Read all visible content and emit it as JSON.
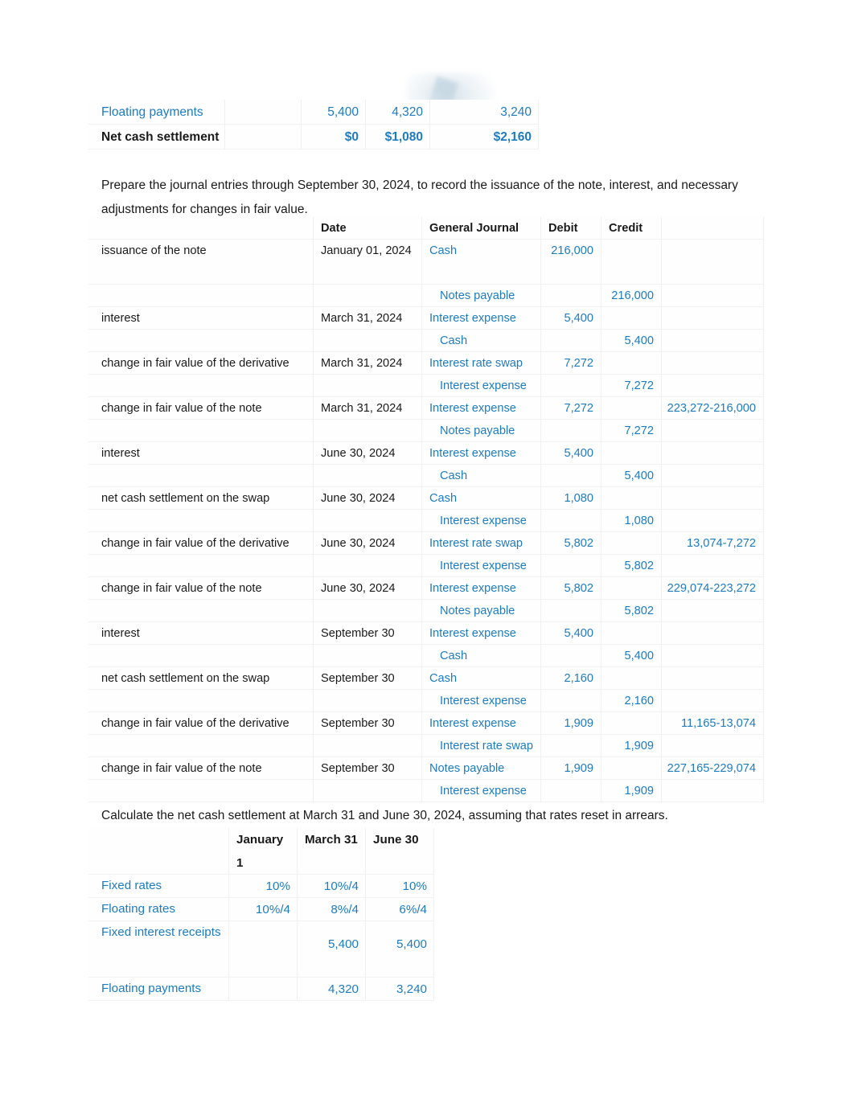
{
  "colors": {
    "accent_blue": "#1d7cc0",
    "text_black": "#1a1a1a",
    "cell_bg": "#fefefe"
  },
  "top_table": {
    "rows": [
      {
        "label": "Floating payments",
        "label_color": "blue",
        "bold": false,
        "c1": "5,400",
        "c2": "4,320",
        "c3": "3,240"
      },
      {
        "label": "Net cash settlement",
        "label_color": "black",
        "bold": true,
        "c1": "$0",
        "c2": "$1,080",
        "c3": "$2,160"
      }
    ]
  },
  "prompts": {
    "journal_entries": "Prepare the journal entries through September 30, 2024, to record the issuance of the note, interest, and necessary adjustments for changes in fair value.",
    "net_cash_settlement": "Calculate the net cash settlement at March 31 and June 30, 2024, assuming that rates reset in arrears."
  },
  "journal_table": {
    "headers": {
      "desc": "",
      "date": "Date",
      "account": "General Journal",
      "debit": "Debit",
      "credit": "Credit",
      "note": ""
    },
    "rows": [
      {
        "desc": "issuance of the note",
        "date": "January 01, 2024",
        "account": "Cash",
        "indent": false,
        "debit": "216,000",
        "credit": "",
        "note": ""
      },
      {
        "desc": "",
        "date": "",
        "account": "Notes payable",
        "indent": true,
        "debit": "",
        "credit": "216,000",
        "note": ""
      },
      {
        "desc": "interest",
        "date": "March 31, 2024",
        "account": "Interest expense",
        "indent": false,
        "debit": "5,400",
        "credit": "",
        "note": ""
      },
      {
        "desc": "",
        "date": "",
        "account": "Cash",
        "indent": true,
        "debit": "",
        "credit": "5,400",
        "note": ""
      },
      {
        "desc": "change in fair value of the derivative",
        "date": "March 31, 2024",
        "account": "Interest rate swap",
        "indent": false,
        "debit": "7,272",
        "credit": "",
        "note": ""
      },
      {
        "desc": "",
        "date": "",
        "account": "Interest expense",
        "indent": true,
        "debit": "",
        "credit": "7,272",
        "note": ""
      },
      {
        "desc": "change in fair value of the note",
        "date": "March 31, 2024",
        "account": "Interest expense",
        "indent": false,
        "debit": "7,272",
        "credit": "",
        "note": "223,272-216,000"
      },
      {
        "desc": "",
        "date": "",
        "account": "Notes payable",
        "indent": true,
        "debit": "",
        "credit": "7,272",
        "note": ""
      },
      {
        "desc": "interest",
        "date": "June 30, 2024",
        "account": "Interest expense",
        "indent": false,
        "debit": "5,400",
        "credit": "",
        "note": ""
      },
      {
        "desc": "",
        "date": "",
        "account": "Cash",
        "indent": true,
        "debit": "",
        "credit": "5,400",
        "note": ""
      },
      {
        "desc": "net cash settlement on the swap",
        "date": "June 30, 2024",
        "account": "Cash",
        "indent": false,
        "debit": "1,080",
        "credit": "",
        "note": ""
      },
      {
        "desc": "",
        "date": "",
        "account": "Interest expense",
        "indent": true,
        "debit": "",
        "credit": "1,080",
        "note": ""
      },
      {
        "desc": "change in fair value of the derivative",
        "date": "June 30, 2024",
        "account": "Interest rate swap",
        "indent": false,
        "debit": "5,802",
        "credit": "",
        "note": "13,074-7,272"
      },
      {
        "desc": "",
        "date": "",
        "account": "Interest expense",
        "indent": true,
        "debit": "",
        "credit": "5,802",
        "note": ""
      },
      {
        "desc": "change in fair value of the note",
        "date": "June 30, 2024",
        "account": "Interest expense",
        "indent": false,
        "debit": "5,802",
        "credit": "",
        "note": "229,074-223,272"
      },
      {
        "desc": "",
        "date": "",
        "account": "Notes payable",
        "indent": true,
        "debit": "",
        "credit": "5,802",
        "note": ""
      },
      {
        "desc": "interest",
        "date": "September 30",
        "account": "Interest expense",
        "indent": false,
        "debit": "5,400",
        "credit": "",
        "note": ""
      },
      {
        "desc": "",
        "date": "",
        "account": "Cash",
        "indent": true,
        "debit": "",
        "credit": "5,400",
        "note": ""
      },
      {
        "desc": "net cash settlement on the swap",
        "date": "September 30",
        "account": "Cash",
        "indent": false,
        "debit": "2,160",
        "credit": "",
        "note": ""
      },
      {
        "desc": "",
        "date": "",
        "account": "Interest expense",
        "indent": true,
        "debit": "",
        "credit": "2,160",
        "note": ""
      },
      {
        "desc": "change in fair value of the derivative",
        "date": "September 30",
        "account": "Interest expense",
        "indent": false,
        "debit": "1,909",
        "credit": "",
        "note": "11,165-13,074"
      },
      {
        "desc": "",
        "date": "",
        "account": "Interest rate swap",
        "indent": true,
        "debit": "",
        "credit": "1,909",
        "note": ""
      },
      {
        "desc": "change in fair value of the note",
        "date": "September 30",
        "account": "Notes payable",
        "indent": false,
        "debit": "1,909",
        "credit": "",
        "note": "227,165-229,074"
      },
      {
        "desc": "",
        "date": "",
        "account": "Interest expense",
        "indent": true,
        "debit": "",
        "credit": "1,909",
        "note": ""
      }
    ]
  },
  "rates_table": {
    "headers": [
      "",
      "January 1",
      "March 31",
      "June 30"
    ],
    "rows": [
      {
        "label": "Fixed rates",
        "v1": "10%",
        "v2": "10%/4",
        "v3": "10%"
      },
      {
        "label": "Floating rates",
        "v1": "10%/4",
        "v2": "8%/4",
        "v3": "6%/4"
      },
      {
        "label": "Fixed interest receipts",
        "v1": "",
        "v2": "5,400",
        "v3": "5,400"
      },
      {
        "label": "Floating payments",
        "v1": "",
        "v2": "4,320",
        "v3": "3,240"
      }
    ]
  }
}
